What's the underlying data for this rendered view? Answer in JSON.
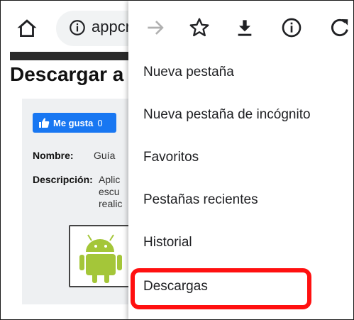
{
  "browser": {
    "url_text": "appcr",
    "icons": [
      "home-icon",
      "info-icon",
      "forward-arrow-icon",
      "star-icon",
      "download-icon",
      "info-icon",
      "reload-icon"
    ]
  },
  "page": {
    "title": "Descargar a",
    "like_button": {
      "label": "Me gusta",
      "count": "0"
    },
    "name_label": "Nombre:",
    "name_value": "Guía",
    "description_label": "Descripción:",
    "description_lines": [
      "Aplic",
      "escu",
      "realic"
    ]
  },
  "menu": {
    "items": [
      "Nueva pestaña",
      "Nueva pestaña de incógnito",
      "Favoritos",
      "Pestañas recientes",
      "Historial",
      "Descargas"
    ]
  },
  "colors": {
    "highlight": "#ff1010",
    "like_blue": "#1877f2",
    "android_green": "#a4c639"
  }
}
